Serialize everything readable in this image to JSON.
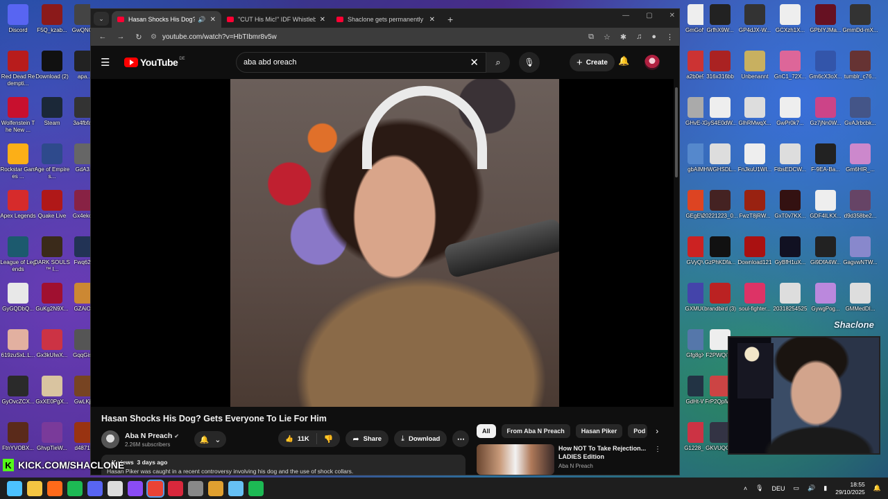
{
  "desktop": {
    "left_icons": [
      {
        "label": "Discord",
        "color": "#5865f2"
      },
      {
        "label": "Red Dead Redempti...",
        "color": "#b81c1c"
      },
      {
        "label": "Wolfenstein The New ...",
        "color": "#c8102e"
      },
      {
        "label": "Rockstar Games ...",
        "color": "#fcaf17"
      },
      {
        "label": "Apex Legends",
        "color": "#d62b2b"
      },
      {
        "label": "League of Legends",
        "color": "#1c5a6e"
      },
      {
        "label": "GyGQDbQ...",
        "color": "#e8e8e8"
      },
      {
        "label": "619zuSxL.L...",
        "color": "#e2b0a0"
      },
      {
        "label": "GyOvcZCX...",
        "color": "#2a2a2a"
      },
      {
        "label": "FtnYVOBX...",
        "color": "#5a2a1a"
      }
    ],
    "left_icons_col2": [
      {
        "label": "F5Q_kzab...",
        "color": "#8b1a1a"
      },
      {
        "label": "Download (2)",
        "color": "#111111"
      },
      {
        "label": "Steam",
        "color": "#1b2838"
      },
      {
        "label": "Age of Empires...",
        "color": "#2e4a8c"
      },
      {
        "label": "Quake Live",
        "color": "#b01818"
      },
      {
        "label": "DARK SOULS™ I...",
        "color": "#3a2a1a"
      },
      {
        "label": "GuKg2N9X...",
        "color": "#a01030"
      },
      {
        "label": "Gx3kUIwX...",
        "color": "#cc3344"
      },
      {
        "label": "GxXE0PgX...",
        "color": "#d9c4a0"
      },
      {
        "label": "GhvpTieW...",
        "color": "#7a3a9a"
      }
    ],
    "left_icons_col3": [
      {
        "label": "GwQNC...",
        "color": "#444444"
      },
      {
        "label": "apa...",
        "color": "#222222"
      },
      {
        "label": "3a4fbfa...",
        "color": "#333333"
      },
      {
        "label": "GdA3...",
        "color": "#666666"
      },
      {
        "label": "Gx4eko...",
        "color": "#882244"
      },
      {
        "label": "Fwq62...",
        "color": "#223355"
      },
      {
        "label": "GZAiO...",
        "color": "#cc8833"
      },
      {
        "label": "GqqGis...",
        "color": "#555555"
      },
      {
        "label": "GwLKj...",
        "color": "#774422"
      },
      {
        "label": "d4871...",
        "color": "#993311"
      }
    ],
    "right_icons_col1": [
      {
        "label": "GmGoN...",
        "color": "#eeeeee"
      },
      {
        "label": "a2b0e9...",
        "color": "#cc3333"
      },
      {
        "label": "GHvE-X...",
        "color": "#aaaaaa"
      },
      {
        "label": "gbAIM...",
        "color": "#5588cc"
      },
      {
        "label": "GEgEW...",
        "color": "#dd4422"
      },
      {
        "label": "GVyQV...",
        "color": "#cc2222"
      },
      {
        "label": "GXMUQ...",
        "color": "#4444aa"
      },
      {
        "label": "Gfg8gX...",
        "color": "#5577aa"
      },
      {
        "label": "GdHt-W...",
        "color": "#223344"
      },
      {
        "label": "G1228_1...",
        "color": "#cc3344"
      }
    ],
    "right_icons_col2": [
      {
        "label": "GrfhX9W...",
        "color": "#222222"
      },
      {
        "label": "316x316bb",
        "color": "#aa2222"
      },
      {
        "label": "GyS4E0dW...",
        "color": "#eeeeee"
      },
      {
        "label": "HWGHSDL...",
        "color": "#dddddd"
      },
      {
        "label": "20221223_0...",
        "color": "#442222"
      },
      {
        "label": "GzPhKDfa...",
        "color": "#111111"
      },
      {
        "label": "brandbird (3)",
        "color": "#bb2222"
      },
      {
        "label": "F2PWQiT...",
        "color": "#eeeeee"
      },
      {
        "label": "FrP2QplW...",
        "color": "#cc4444"
      },
      {
        "label": "GKVUQG...",
        "color": "#333344"
      }
    ],
    "right_icons_col3": [
      {
        "label": "GP4dJX-W...",
        "color": "#333333"
      },
      {
        "label": "Unbenannt",
        "color": "#c8b060"
      },
      {
        "label": "GlhRMwqX...",
        "color": "#dddddd"
      },
      {
        "label": "FnJkuU1WI...",
        "color": "#eeeeee"
      },
      {
        "label": "FwzT8jRW...",
        "color": "#992211"
      },
      {
        "label": "Download121",
        "color": "#aa1111"
      },
      {
        "label": "soul-fighter...",
        "color": "#dd3366"
      }
    ],
    "right_icons_col4": [
      {
        "label": "GCXzh1X...",
        "color": "#eeeeee"
      },
      {
        "label": "GnC1_72X...",
        "color": "#dd6699"
      },
      {
        "label": "GwPr0k7...",
        "color": "#eeeeee"
      },
      {
        "label": "FtbsEDCW...",
        "color": "#dddddd"
      },
      {
        "label": "GxT0v7KX...",
        "color": "#331111"
      },
      {
        "label": "GyBfH1uX...",
        "color": "#111122"
      },
      {
        "label": "20318254525",
        "color": "#dddddd"
      }
    ],
    "right_icons_col5": [
      {
        "label": "GPbIYJMa...",
        "color": "#661122"
      },
      {
        "label": "Gm6cX3oX...",
        "color": "#3355aa"
      },
      {
        "label": "Gz7jNn0W...",
        "color": "#cc4488"
      },
      {
        "label": "F-9EA-Ba...",
        "color": "#222222"
      },
      {
        "label": "GDF4ILKX...",
        "color": "#eeeeee"
      },
      {
        "label": "Gi9DfA4W...",
        "color": "#222222"
      },
      {
        "label": "GywgPog...",
        "color": "#bb88dd"
      }
    ],
    "right_icons_col6": [
      {
        "label": "GmmDd-mX...",
        "color": "#333333"
      },
      {
        "label": "tumblr_c76...",
        "color": "#663333"
      },
      {
        "label": "GvAJrbcbk...",
        "color": "#445588"
      },
      {
        "label": "Gm6HlR_...",
        "color": "#cc88cc"
      },
      {
        "label": "d9d358be2...",
        "color": "#664466"
      },
      {
        "label": "GagvwNTW...",
        "color": "#8888cc"
      },
      {
        "label": "GMMedDI...",
        "color": "#dddddd"
      }
    ]
  },
  "browser": {
    "tabs": [
      {
        "title": "Hasan Shocks His Dog? Gets",
        "active": true,
        "sound": true
      },
      {
        "title": "\"CUT His Mic!\" IDF Whistleblow",
        "active": false,
        "sound": false
      },
      {
        "title": "Shaclone gets permanently ban",
        "active": false,
        "sound": false
      }
    ],
    "new_tab": "+",
    "url": "youtube.com/watch?v=HbTIbmr8v5w"
  },
  "youtube": {
    "logo_text": "YouTube",
    "region": "DE",
    "search_value": "aba abd oreach",
    "create_label": "Create",
    "video_title": "Hasan Shocks His Dog? Gets Everyone To Lie For Him",
    "channel": {
      "name": "Aba N Preach",
      "subscribers": "2.26M subscribers"
    },
    "like_count": "11K",
    "share_label": "Share",
    "download_label": "Download",
    "description": {
      "views": "...K views",
      "date": "3 days ago",
      "text": "Hasan Piker was caught in a recent controversy involving his dog and the use of shock collars."
    },
    "chips": [
      "All",
      "From Aba N Preach",
      "Hasan Piker",
      "Pod"
    ],
    "recommendation": {
      "title": "How NOT To Take Rejection... LADIES Edition",
      "channel": "Aba N Preach"
    }
  },
  "overlay": {
    "kick_url": "KICK.COM/SHACLONE",
    "brand": "Shaclone"
  },
  "taskbar": {
    "language": "DEU",
    "time": "18:55",
    "date": "29/10/2025",
    "apps": [
      {
        "name": "start-icon",
        "color": "#4cc2ff"
      },
      {
        "name": "file-explorer-icon",
        "color": "#f4c542"
      },
      {
        "name": "brave-icon",
        "color": "#ff6a1a"
      },
      {
        "name": "spotify-icon",
        "color": "#1db954"
      },
      {
        "name": "discord-icon",
        "color": "#5865f2"
      },
      {
        "name": "obs-icon",
        "color": "#dddddd"
      },
      {
        "name": "purple-app-icon",
        "color": "#8a4cf5"
      },
      {
        "name": "chrome-icon",
        "color": "#ea4335"
      },
      {
        "name": "red-app-icon",
        "color": "#d8283c"
      },
      {
        "name": "game-app-icon",
        "color": "#888888"
      },
      {
        "name": "shield-app-icon",
        "color": "#e0a030"
      },
      {
        "name": "steam-icon",
        "color": "#66c0f4"
      },
      {
        "name": "spotify-2-icon",
        "color": "#1db954"
      }
    ]
  }
}
